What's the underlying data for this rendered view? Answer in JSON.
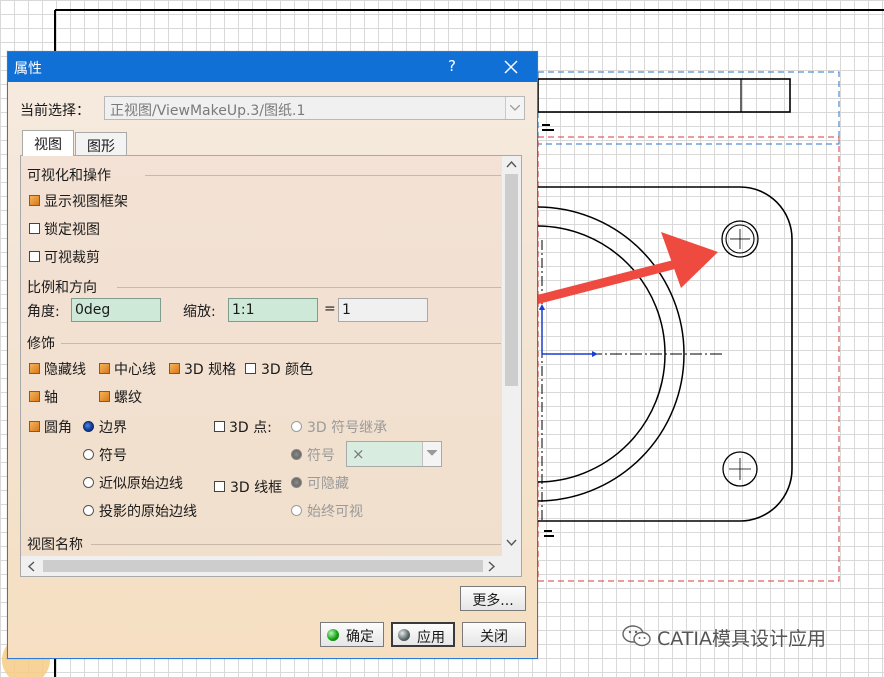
{
  "dialog": {
    "title": "属性",
    "help_label": "?",
    "current_selection_label": "当前选择：",
    "current_selection_value": "正视图/ViewMakeUp.3/图纸.1",
    "tabs": [
      "视图",
      "图形"
    ],
    "sections": {
      "visualization": {
        "title": "可视化和操作",
        "show_frame": "显示视图框架",
        "lock_view": "锁定视图",
        "visual_clip": "可视裁剪"
      },
      "scale": {
        "title": "比例和方向",
        "angle_label": "角度:",
        "angle_value": "0deg",
        "scale_label": "缩放:",
        "scale_value": "1:1",
        "equals": "=",
        "scale_result": "1"
      },
      "dress_up": {
        "title": "修饰",
        "hidden_lines": "隐藏线",
        "center_line": "中心线",
        "spec_3d": "3D 规格",
        "color_3d": "3D 颜色",
        "axis": "轴",
        "thread": "螺纹",
        "fillet": "圆角",
        "boundary": "边界",
        "symbol": "符号",
        "approx_original_edges": "近似原始边线",
        "projected_original_edges": "投影的原始边线",
        "points_3d": "3D 点:",
        "symbol_inherit": "3D 符号继承",
        "symbol_radio": "符号",
        "symbol_value": "×",
        "wireframe_3d": "3D 线框",
        "can_hide": "可隐藏",
        "always_visible": "始终可视"
      },
      "view_name": {
        "title": "视图名称"
      }
    },
    "buttons": {
      "more": "更多...",
      "ok": "确定",
      "apply": "应用",
      "close": "关闭"
    }
  },
  "watermark": "CATIA模具设计应用",
  "colors": {
    "titlebar": "#1170d6",
    "arrow": "#ee4a3f",
    "field_green": "#cfe9d8"
  }
}
